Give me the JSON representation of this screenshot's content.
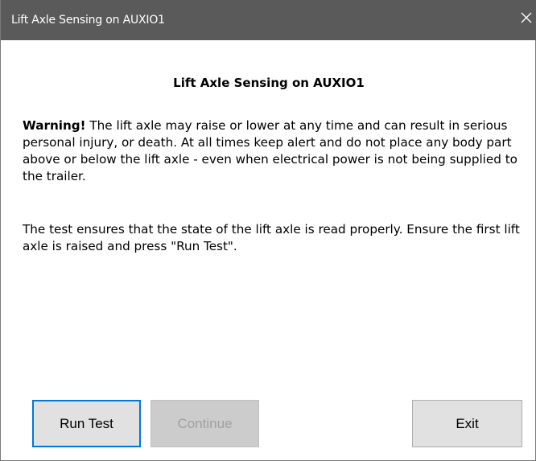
{
  "window": {
    "title": "Lift Axle Sensing on AUXIO1"
  },
  "content": {
    "heading": "Lift Axle Sensing on AUXIO1",
    "warning_label": "Warning!",
    "warning_text": " The lift axle may raise or lower at any time and can result in serious personal injury, or death. At all times keep alert and do not place any body part above or below the lift axle - even when electrical power is not being supplied to the trailer.",
    "test_text": "The test ensures that the state of the lift axle is read properly. Ensure the first lift axle is raised and press \"Run Test\"."
  },
  "buttons": {
    "run_test": "Run Test",
    "continue": "Continue",
    "exit": "Exit"
  },
  "colors": {
    "titlebar": "#5a5a5a",
    "focus_border": "#0078d7",
    "button_bg": "#e1e1e1",
    "disabled_text": "#a0a0a0"
  }
}
